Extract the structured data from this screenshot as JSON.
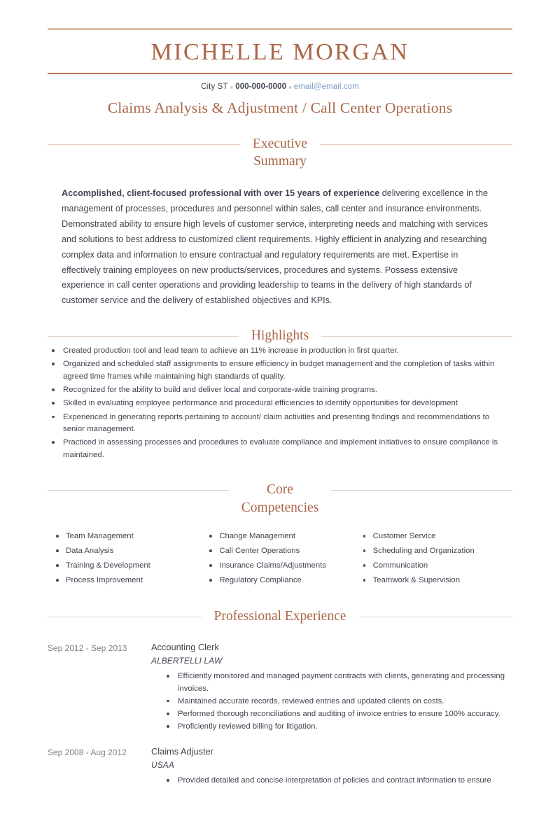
{
  "header": {
    "name": "MICHELLE MORGAN",
    "contact": {
      "location": "City ST",
      "phone": "000-000-0000",
      "email": "email@email.com",
      "separator": "▪"
    },
    "headline": "Claims Analysis & Adjustment / Call Center Operations"
  },
  "sections": {
    "summary": {
      "title": "Executive\nSummary",
      "lead": "Accomplished, client-focused professional with over 15 years of experience",
      "body": " delivering excellence in the management of processes, procedures and personnel within sales, call center and insurance environments. Demonstrated ability to ensure high levels of customer service, interpreting needs and matching with services and solutions to best address to customized client requirements.  Highly efficient in analyzing and researching complex data and information to ensure contractual and regulatory requirements are met. Expertise in effectively training employees on new products/services, procedures and systems. Possess extensive experience in call center operations and providing leadership to teams in the delivery of high standards of customer service and the delivery of established objectives and KPIs."
    },
    "highlights": {
      "title": "Highlights",
      "items": [
        "Created production tool and lead team to achieve an 11% increase in production in first quarter.",
        "Organized and scheduled staff assignments to ensure efficiency in budget management and the completion of tasks within agreed time frames while maintaining high standards of quality.",
        "Recognized for the ability to build and deliver local and corporate-wide training programs.",
        "Skilled in evaluating employee performance and procedural efficiencies to identify opportunities for development",
        "Experienced in generating reports pertaining to account/ claim activities and presenting findings and recommendations to senior management.",
        "Practiced in assessing processes and procedures to evaluate compliance and implement initiatives to ensure compliance is maintained."
      ]
    },
    "competencies": {
      "title": "Core\nCompetencies",
      "columns": [
        [
          "Team Management",
          "Data Analysis",
          "Training & Development",
          "Process Improvement"
        ],
        [
          "Change Management",
          "Call Center Operations",
          "Insurance Claims/Adjustments",
          "Regulatory Compliance"
        ],
        [
          "Customer Service",
          "Scheduling and Organization",
          "Communication",
          "Teamwork & Supervision"
        ]
      ]
    },
    "experience": {
      "title": "Professional Experience",
      "items": [
        {
          "dates": "Sep 2012 - Sep 2013",
          "job_title": "Accounting Clerk",
          "company": "ALBERTELLI LAW",
          "bullets": [
            "Efficiently monitored and managed payment contracts with clients, generating and processing invoices.",
            "Maintained accurate records, reviewed entries and updated clients on costs.",
            "Performed thorough reconciliations and auditing of invoice entries to ensure 100% accuracy.",
            "Proficiently reviewed billing for litigation."
          ]
        },
        {
          "dates": "Sep 2008 - Aug 2012",
          "job_title": "Claims Adjuster",
          "company": "USAA",
          "bullets": [
            "Provided detailed and concise interpretation of policies and contract information to ensure"
          ]
        }
      ]
    }
  },
  "colors": {
    "accent": "#ab6647",
    "rule_light": "#e3cec1",
    "rule_top": "#dcbdac",
    "rule_name": "#b4714f",
    "text": "#3f4550",
    "muted": "#7d8085",
    "link": "#7a9cc6"
  }
}
